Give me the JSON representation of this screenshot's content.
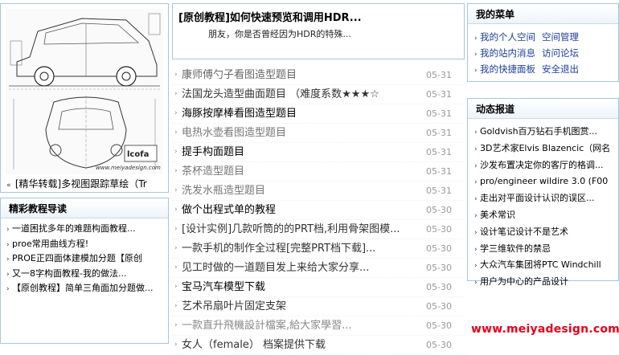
{
  "featured": {
    "caption": "[精华转载]多视图跟踪草绘（Tr",
    "drawing_watermark": "www.meiyadesign.com"
  },
  "guide": {
    "title": "精彩教程导读",
    "items": [
      "一道困扰多年的难题构面教程...",
      "proe常用曲线方程!",
      "PROE正四面体建模加分题【原创",
      "又一8字构面教程-我的做法...",
      "【原创教程】简单三角面加分题做..."
    ]
  },
  "headline": {
    "title": "[原创教程]如何快速预览和调用HDR...",
    "summary": "朋友，你是否曾经因为HDR的特殊..."
  },
  "latest": [
    {
      "title": "康师傅勺子看图造型题目",
      "date": "05-31",
      "color": "#666666"
    },
    {
      "title": "法国龙头造型曲面题目  （难度系数★★★☆",
      "date": "05-31",
      "color": "#333333"
    },
    {
      "title": "海豚按摩棒看图造型题目",
      "date": "05-31",
      "color": "#000000"
    },
    {
      "title": "电热水壶看图造型题目",
      "date": "05-31",
      "color": "#777777"
    },
    {
      "title": "提手构面题目",
      "date": "05-31",
      "color": "#000000"
    },
    {
      "title": "茶杯造型题目",
      "date": "05-31",
      "color": "#777777"
    },
    {
      "title": "洗发水瓶造型题目",
      "date": "05-31",
      "color": "#777777"
    },
    {
      "title": "做个出程式单的教程",
      "date": "05-30",
      "color": "#000000"
    },
    {
      "title": "[设计实例]几款听筒的的PRT档,利用骨架图模...",
      "date": "05-30",
      "color": "#333333"
    },
    {
      "title": "一款手机的制作全过程[完整PRT档下载]...",
      "date": "05-30",
      "color": "#333333"
    },
    {
      "title": "见工时做的一道题目发上来给大家分享...",
      "date": "05-30",
      "color": "#333333"
    },
    {
      "title": "宝马汽车模型下载",
      "date": "05-30",
      "color": "#000000"
    },
    {
      "title": "艺术吊扇叶片固定支架",
      "date": "05-30",
      "color": "#333333"
    },
    {
      "title": "一款直升飛機設計檔案,給大家學習...",
      "date": "05-30",
      "color": "#888888"
    },
    {
      "title": "女人（female） 档案提供下载",
      "date": "05-30",
      "color": "#333333"
    }
  ],
  "mymenu": {
    "title": "我的菜单",
    "rows": [
      [
        "我的个人空间",
        "空间管理"
      ],
      [
        "我的站内消息",
        "访问论坛"
      ],
      [
        "我的快捷面板",
        "安全退出"
      ]
    ]
  },
  "news": {
    "title": "动态报道",
    "items": [
      "Goldvish百万钻石手机图赏...",
      "3D艺术家Elvis Blazencic（网名",
      "沙发布置决定你的客厅的格调...",
      "pro/engineer wildire 3.0 (F00",
      "走出对平面设计认识的误区...",
      "美术常识",
      "设计笔记设计不是艺术",
      "学三维软件的禁忌",
      "大众汽车集团将PTC Windchill",
      "用户为中心的产品设计"
    ]
  },
  "watermark": "www.meiyadesign.com",
  "colors": {
    "border": "#a9c6de",
    "link": "#1d3c9b",
    "accent": "#e8001c",
    "date": "#999999"
  }
}
